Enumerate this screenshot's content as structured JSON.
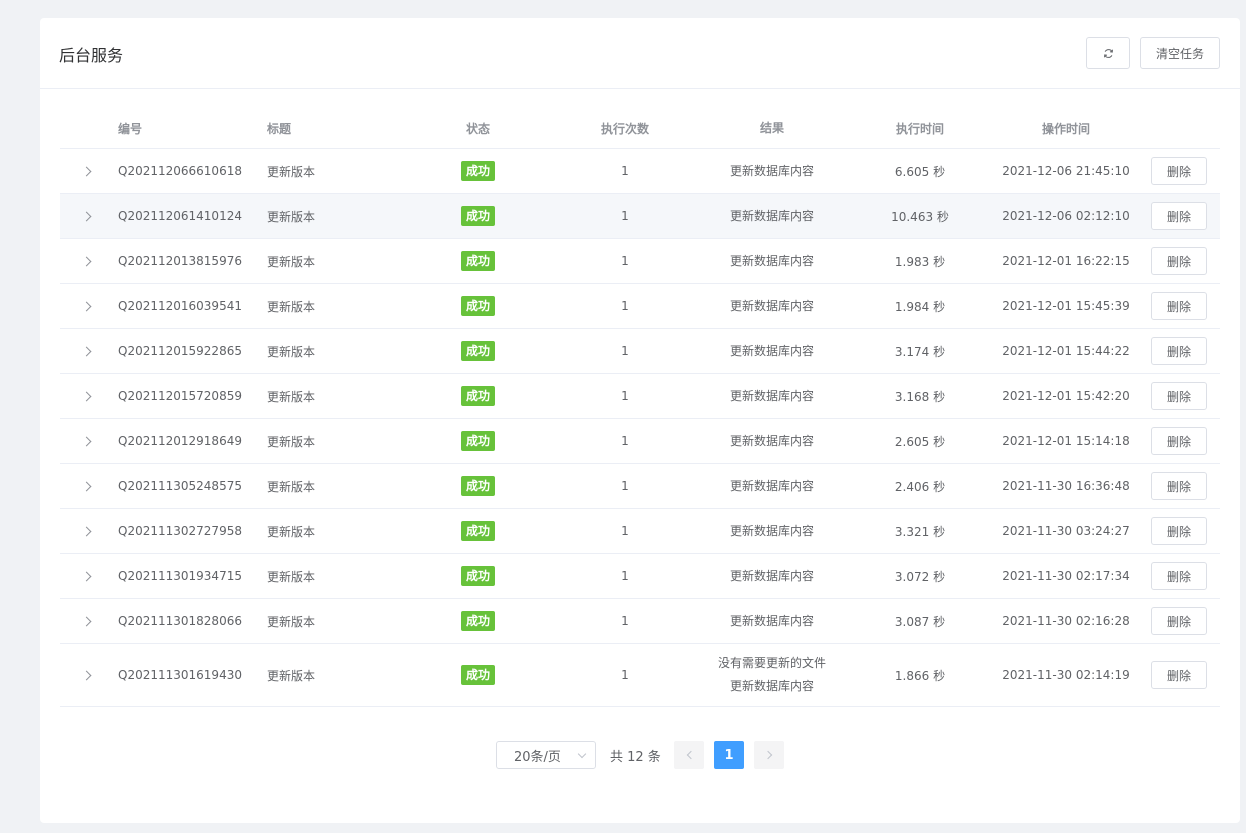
{
  "header": {
    "title": "后台服务",
    "clear_label": "清空任务",
    "refresh_icon": "refresh-icon"
  },
  "table": {
    "columns": {
      "id": "编号",
      "title": "标题",
      "status": "状态",
      "count": "执行次数",
      "result": "结果",
      "duration": "执行时间",
      "optime": "操作时间"
    },
    "delete_label": "删除",
    "rows": [
      {
        "id": "Q202112066610618",
        "title": "更新版本",
        "status": "成功",
        "count": "1",
        "result": "更新数据库内容",
        "duration": "6.605 秒",
        "optime": "2021-12-06 21:45:10"
      },
      {
        "id": "Q202112061410124",
        "title": "更新版本",
        "status": "成功",
        "count": "1",
        "result": "更新数据库内容",
        "duration": "10.463 秒",
        "optime": "2021-12-06 02:12:10"
      },
      {
        "id": "Q202112013815976",
        "title": "更新版本",
        "status": "成功",
        "count": "1",
        "result": "更新数据库内容",
        "duration": "1.983 秒",
        "optime": "2021-12-01 16:22:15"
      },
      {
        "id": "Q202112016039541",
        "title": "更新版本",
        "status": "成功",
        "count": "1",
        "result": "更新数据库内容",
        "duration": "1.984 秒",
        "optime": "2021-12-01 15:45:39"
      },
      {
        "id": "Q202112015922865",
        "title": "更新版本",
        "status": "成功",
        "count": "1",
        "result": "更新数据库内容",
        "duration": "3.174 秒",
        "optime": "2021-12-01 15:44:22"
      },
      {
        "id": "Q202112015720859",
        "title": "更新版本",
        "status": "成功",
        "count": "1",
        "result": "更新数据库内容",
        "duration": "3.168 秒",
        "optime": "2021-12-01 15:42:20"
      },
      {
        "id": "Q202112012918649",
        "title": "更新版本",
        "status": "成功",
        "count": "1",
        "result": "更新数据库内容",
        "duration": "2.605 秒",
        "optime": "2021-12-01 15:14:18"
      },
      {
        "id": "Q202111305248575",
        "title": "更新版本",
        "status": "成功",
        "count": "1",
        "result": "更新数据库内容",
        "duration": "2.406 秒",
        "optime": "2021-11-30 16:36:48"
      },
      {
        "id": "Q202111302727958",
        "title": "更新版本",
        "status": "成功",
        "count": "1",
        "result": "更新数据库内容",
        "duration": "3.321 秒",
        "optime": "2021-11-30 03:24:27"
      },
      {
        "id": "Q202111301934715",
        "title": "更新版本",
        "status": "成功",
        "count": "1",
        "result": "更新数据库内容",
        "duration": "3.072 秒",
        "optime": "2021-11-30 02:17:34"
      },
      {
        "id": "Q202111301828066",
        "title": "更新版本",
        "status": "成功",
        "count": "1",
        "result": "更新数据库内容",
        "duration": "3.087 秒",
        "optime": "2021-11-30 02:16:28"
      },
      {
        "id": "Q202111301619430",
        "title": "更新版本",
        "status": "成功",
        "count": "1",
        "result": "没有需要更新的文件更新数据库内容",
        "duration": "1.866 秒",
        "optime": "2021-11-30 02:14:19"
      }
    ]
  },
  "pagination": {
    "page_size": "20条/页",
    "total": "共 12 条",
    "current_page": "1"
  },
  "colors": {
    "success_tag": "#67c23a",
    "primary": "#409eff"
  }
}
